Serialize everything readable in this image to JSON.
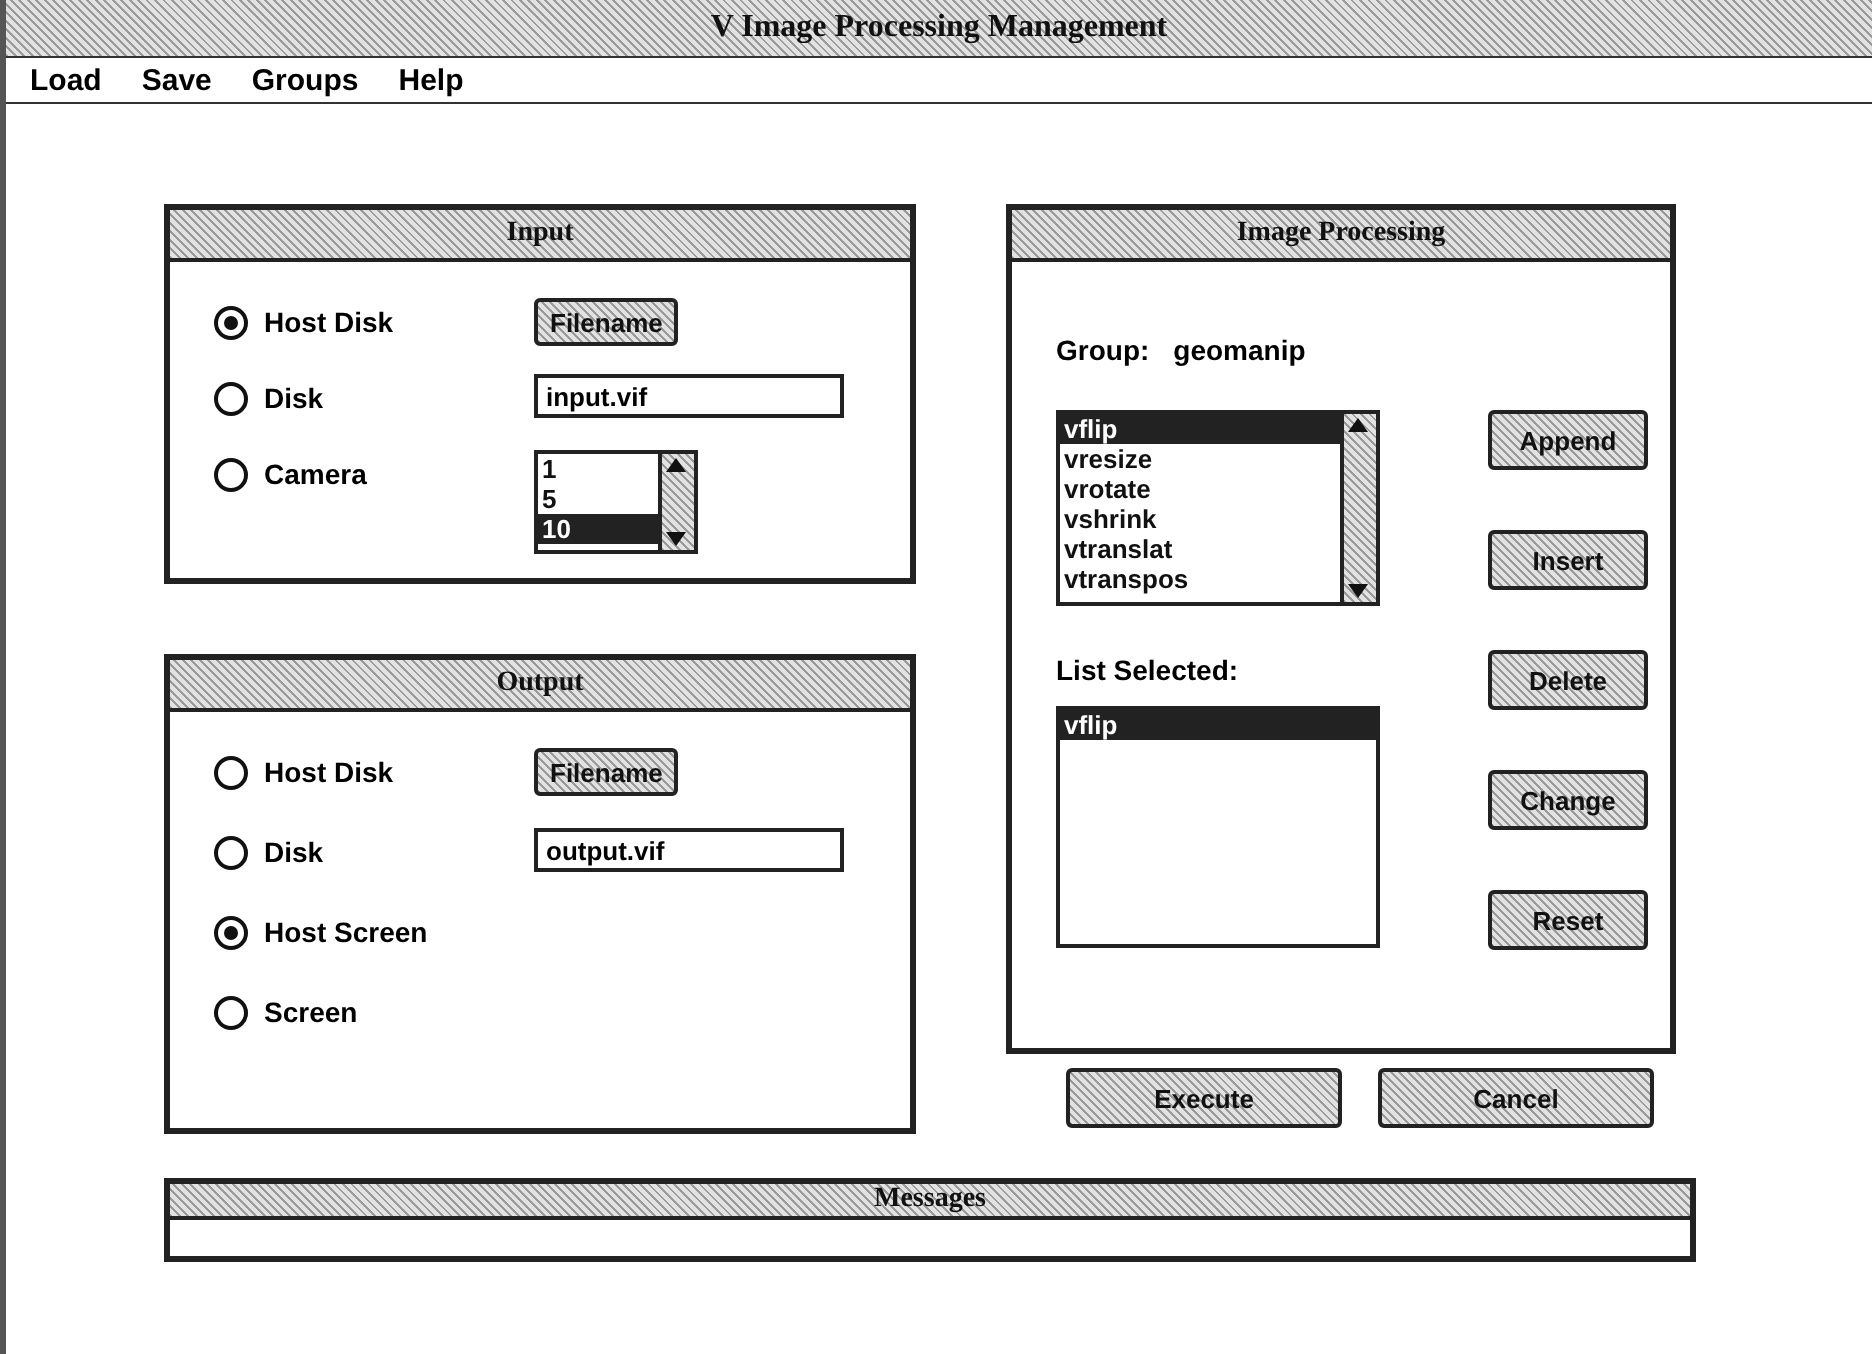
{
  "window": {
    "title": "V Image Processing Management"
  },
  "menu": [
    "Load",
    "Save",
    "Groups",
    "Help"
  ],
  "input": {
    "title": "Input",
    "options": [
      {
        "label": "Host Disk",
        "selected": true
      },
      {
        "label": "Disk",
        "selected": false
      },
      {
        "label": "Camera",
        "selected": false
      }
    ],
    "filename_button": "Filename",
    "disk_field": {
      "value": "input.vif"
    },
    "camera_list": [
      {
        "label": "1",
        "selected": false
      },
      {
        "label": "5",
        "selected": false
      },
      {
        "label": "10",
        "selected": true
      }
    ]
  },
  "output": {
    "title": "Output",
    "options": [
      {
        "label": "Host Disk",
        "selected": false
      },
      {
        "label": "Disk",
        "selected": false
      },
      {
        "label": "Host Screen",
        "selected": true
      },
      {
        "label": "Screen",
        "selected": false
      }
    ],
    "filename_button": "Filename",
    "disk_field": {
      "value": "output.vif"
    }
  },
  "image_processing": {
    "title": "Image Processing",
    "group_label": "Group:",
    "group_value": "geomanip",
    "functions": [
      {
        "label": "vflip",
        "selected": true
      },
      {
        "label": "vresize",
        "selected": false
      },
      {
        "label": "vrotate",
        "selected": false
      },
      {
        "label": "vshrink",
        "selected": false
      },
      {
        "label": "vtranslat",
        "selected": false
      },
      {
        "label": "vtranspos",
        "selected": false
      }
    ],
    "list_selected_label": "List Selected:",
    "list_selected": [
      {
        "label": "vflip",
        "selected": true
      }
    ],
    "buttons": [
      "Append",
      "Insert",
      "Delete",
      "Change",
      "Reset"
    ]
  },
  "actions": [
    "Execute",
    "Cancel"
  ],
  "messages": {
    "title": "Messages"
  }
}
